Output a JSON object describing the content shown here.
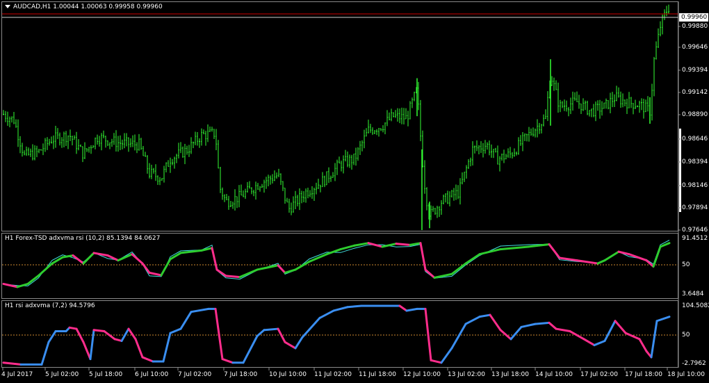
{
  "main": {
    "title": "AUDCAD,H1  1.00044 1.00063 0.99958 0.99960",
    "price_box": "0.99960",
    "price_labels": [
      "0.99880",
      "0.99646",
      "0.99394",
      "0.99142",
      "0.98890",
      "0.98646",
      "0.98394",
      "0.98146",
      "0.97894",
      "0.97646"
    ],
    "line_color": "#cc0000",
    "bar_color": "#33ff33"
  },
  "ind1": {
    "title": "H1 Forex-TSD adxvma rsi (10,2) 85.1394 84.0627",
    "labels": [
      "91.4512",
      "50",
      "3.6484"
    ],
    "up_color": "#2ecc2e",
    "down_color": "#ff2d8c",
    "signal_color": "#40e0e0"
  },
  "ind2": {
    "title": "H1 rsi adxvma (7,2) 94.5796",
    "labels": [
      "104.5082",
      "50",
      "-2.7962"
    ],
    "up_color": "#3a8ef0",
    "down_color": "#ff2d8c"
  },
  "time_axis": [
    "4 Jul 2017",
    "5 Jul 02:00",
    "5 Jul 18:00",
    "6 Jul 10:00",
    "7 Jul 02:00",
    "7 Jul 18:00",
    "10 Jul 10:00",
    "11 Jul 02:00",
    "11 Jul 18:00",
    "12 Jul 10:00",
    "13 Jul 02:00",
    "13 Jul 18:00",
    "14 Jul 10:00",
    "17 Jul 02:00",
    "17 Jul 18:00",
    "18 Jul 10:00"
  ],
  "chart_data": [
    {
      "type": "candlestick",
      "title": "AUDCAD,H1  1.00044 1.00063 0.99958 0.99960",
      "ylim": [
        0.976,
        0.9998
      ],
      "x": [
        "4 Jul 2017",
        "5 Jul 02:00",
        "5 Jul 18:00",
        "6 Jul 10:00",
        "7 Jul 02:00",
        "7 Jul 18:00",
        "10 Jul 10:00",
        "11 Jul 02:00",
        "11 Jul 18:00",
        "12 Jul 10:00",
        "13 Jul 02:00",
        "13 Jul 18:00",
        "14 Jul 10:00",
        "17 Jul 02:00",
        "17 Jul 18:00",
        "18 Jul 10:00"
      ],
      "values": [
        0.9882,
        0.984,
        0.9858,
        0.9848,
        0.9815,
        0.9858,
        0.979,
        0.9805,
        0.9818,
        0.9865,
        0.99,
        0.9785,
        0.9858,
        0.99,
        0.989,
        0.9996
      ],
      "last": 0.9996
    },
    {
      "type": "line",
      "title": "H1 Forex-TSD adxvma rsi (10,2) 85.1394 84.0627",
      "ylim": [
        3.6484,
        91.4512
      ],
      "values": [
        10,
        14,
        45,
        72,
        50,
        75,
        20,
        30,
        60,
        82,
        75,
        10,
        40,
        80,
        55,
        85
      ]
    },
    {
      "type": "line",
      "title": "H1 rsi adxvma (7,2) 94.5796",
      "ylim": [
        -2.7962,
        104.5082
      ],
      "values": [
        2,
        65,
        75,
        5,
        92,
        8,
        60,
        45,
        92,
        100,
        95,
        5,
        85,
        75,
        35,
        95
      ]
    }
  ]
}
